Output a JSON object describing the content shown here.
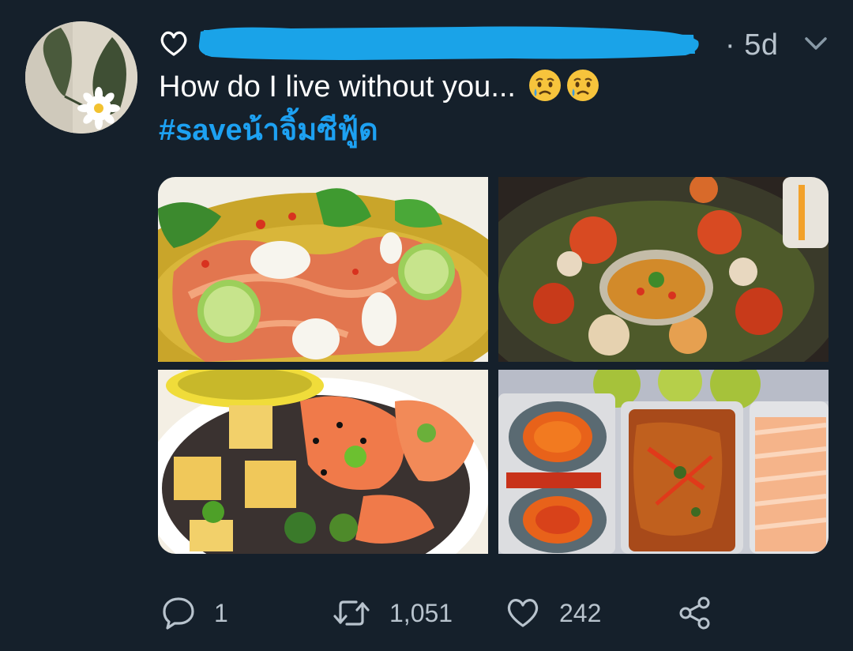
{
  "tweet": {
    "time": "· 5d",
    "text": "How do I live without you...",
    "emoji": [
      "crying-face",
      "crying-face"
    ],
    "hashtag": "#saveน้าจิ้มซีฟู้ด",
    "colors": {
      "background": "#15202b",
      "text": "#ffffff",
      "secondary": "#b8c3cd",
      "link": "#1da1f2",
      "redaction": "#1aa3e8"
    }
  },
  "media": [
    {
      "label": "salmon-ceviche-photo"
    },
    {
      "label": "crab-platter-photo"
    },
    {
      "label": "poke-bowl-photo"
    },
    {
      "label": "takeout-seafood-photo"
    }
  ],
  "actions": {
    "reply_count": "1",
    "retweet_count": "1,051",
    "like_count": "242"
  }
}
